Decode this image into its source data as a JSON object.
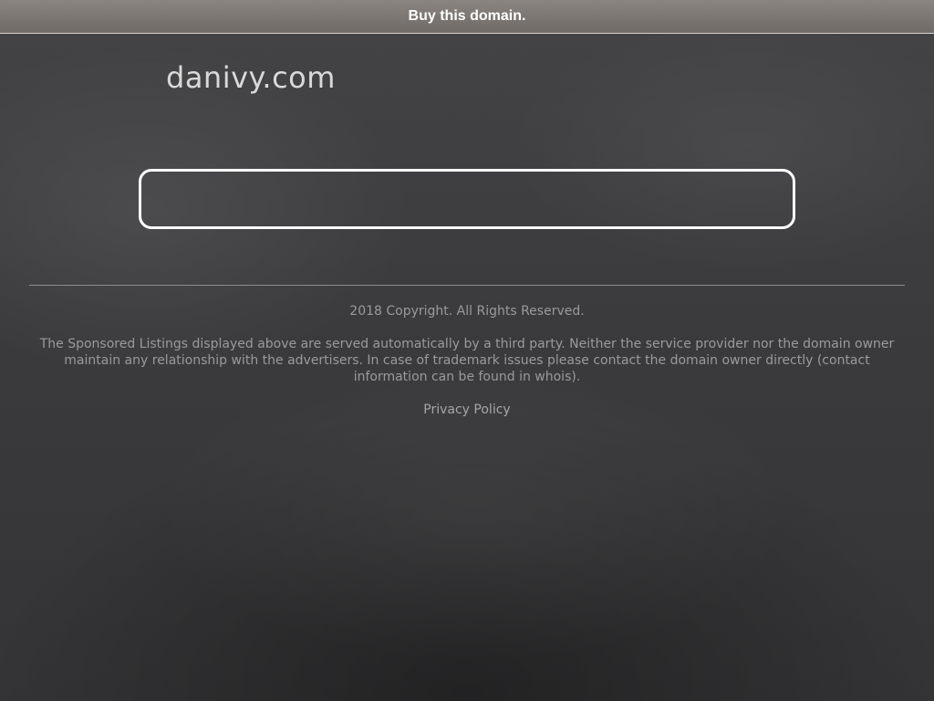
{
  "top_bar": {
    "label": "Buy this domain."
  },
  "header": {
    "domain": "danivy.com"
  },
  "search": {
    "value": "",
    "placeholder": ""
  },
  "footer": {
    "copyright": "2018 Copyright. All Rights Reserved.",
    "disclaimer": "The Sponsored Listings displayed above are served automatically by a third party. Neither the service provider nor the domain owner maintain any relationship with the advertisers. In case of trademark issues please contact the domain owner directly (contact information can be found in whois).",
    "privacy_link": "Privacy Policy"
  }
}
